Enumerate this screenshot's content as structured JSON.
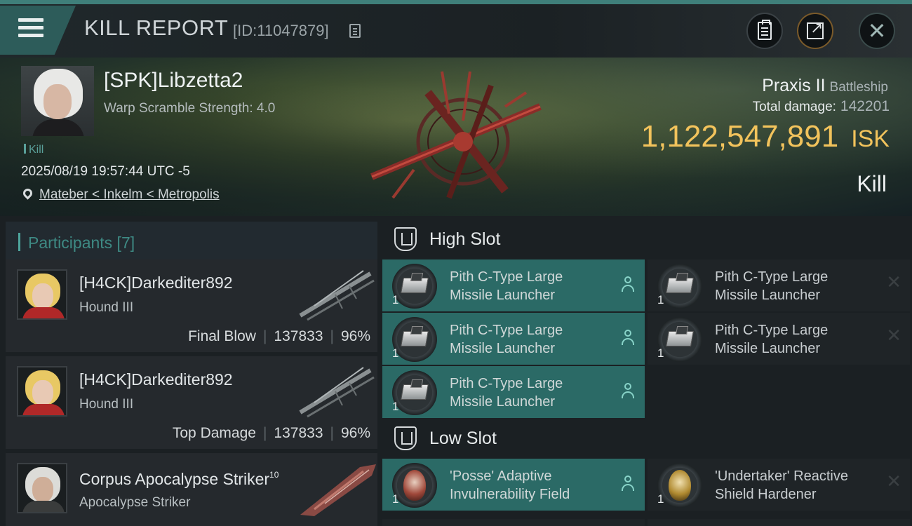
{
  "header": {
    "title": "KILL REPORT",
    "report_id": "[ID:11047879]"
  },
  "victim": {
    "name": "[SPK]Libzetta2",
    "warp_scramble": "Warp Scramble Strength: 4.0",
    "kill_tag": "Kill",
    "datetime": "2025/08/19 19:57:44 UTC -5",
    "location": "Mateber < Inkelm < Metropolis"
  },
  "ship": {
    "name": "Praxis II",
    "class": "Battleship",
    "total_damage_label": "Total damage:",
    "total_damage": "142201",
    "isk_value": "1,122,547,891",
    "isk_unit": "ISK",
    "result": "Kill"
  },
  "participants": {
    "header": "Participants [7]",
    "rows": [
      {
        "name": "[H4CK]Darkediter892",
        "ship": "Hound III",
        "role": "Final Blow",
        "damage": "137833",
        "percent": "96%"
      },
      {
        "name": "[H4CK]Darkediter892",
        "ship": "Hound III",
        "role": "Top Damage",
        "damage": "137833",
        "percent": "96%"
      },
      {
        "name": "Corpus Apocalypse Striker",
        "level": "10",
        "ship": "Apocalypse Striker"
      }
    ]
  },
  "high_slot": {
    "label": "High Slot",
    "modules": [
      {
        "qty": "1",
        "line1": "Pith C-Type Large",
        "line2": "Missile Launcher",
        "state": "dropped"
      },
      {
        "qty": "1",
        "line1": "Pith C-Type Large",
        "line2": "Missile Launcher",
        "state": "destroyed"
      },
      {
        "qty": "1",
        "line1": "Pith C-Type Large",
        "line2": "Missile Launcher",
        "state": "dropped"
      },
      {
        "qty": "1",
        "line1": "Pith C-Type Large",
        "line2": "Missile Launcher",
        "state": "destroyed"
      },
      {
        "qty": "1",
        "line1": "Pith C-Type Large",
        "line2": "Missile Launcher",
        "state": "dropped"
      }
    ]
  },
  "low_slot": {
    "label": "Low Slot",
    "modules": [
      {
        "qty": "1",
        "line1": "'Posse' Adaptive",
        "line2": "Invulnerability Field",
        "state": "dropped"
      },
      {
        "qty": "1",
        "line1": "'Undertaker' Reactive",
        "line2": "Shield Hardener",
        "state": "destroyed"
      }
    ]
  },
  "colors": {
    "accent_teal": "#2b6a66",
    "isk_gold": "#f2c35c",
    "participants_header": "#3e8a84"
  }
}
